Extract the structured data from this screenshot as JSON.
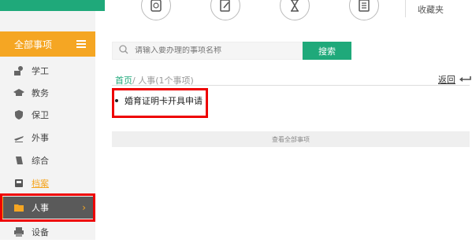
{
  "sidebar": {
    "header_label": "全部事项",
    "items": [
      {
        "label": "学工",
        "icon": "student-icon"
      },
      {
        "label": "教务",
        "icon": "graduation-cap-icon"
      },
      {
        "label": "保卫",
        "icon": "shield-icon"
      },
      {
        "label": "外事",
        "icon": "plane-icon"
      },
      {
        "label": "综合",
        "icon": "tag-icon"
      },
      {
        "label": "档案",
        "icon": "archive-icon"
      },
      {
        "label": "人事",
        "icon": "folder-icon"
      },
      {
        "label": "设备",
        "icon": "printer-icon"
      }
    ],
    "active_label": "人事",
    "chevron": "›"
  },
  "topbar": {
    "favorites_label": "收藏夹"
  },
  "search": {
    "placeholder": "请输入要办理的事项名称",
    "button_label": "搜索"
  },
  "breadcrumb": {
    "home": "首页",
    "current": "/ 人事(1个事项)"
  },
  "back_label": "返回",
  "items": [
    "婚育证明卡开具申请"
  ],
  "view_all_label": "查看全部事项",
  "colors": {
    "accent_green": "#1fa97a",
    "accent_orange": "#f5a623",
    "highlight_red": "#e00000"
  }
}
